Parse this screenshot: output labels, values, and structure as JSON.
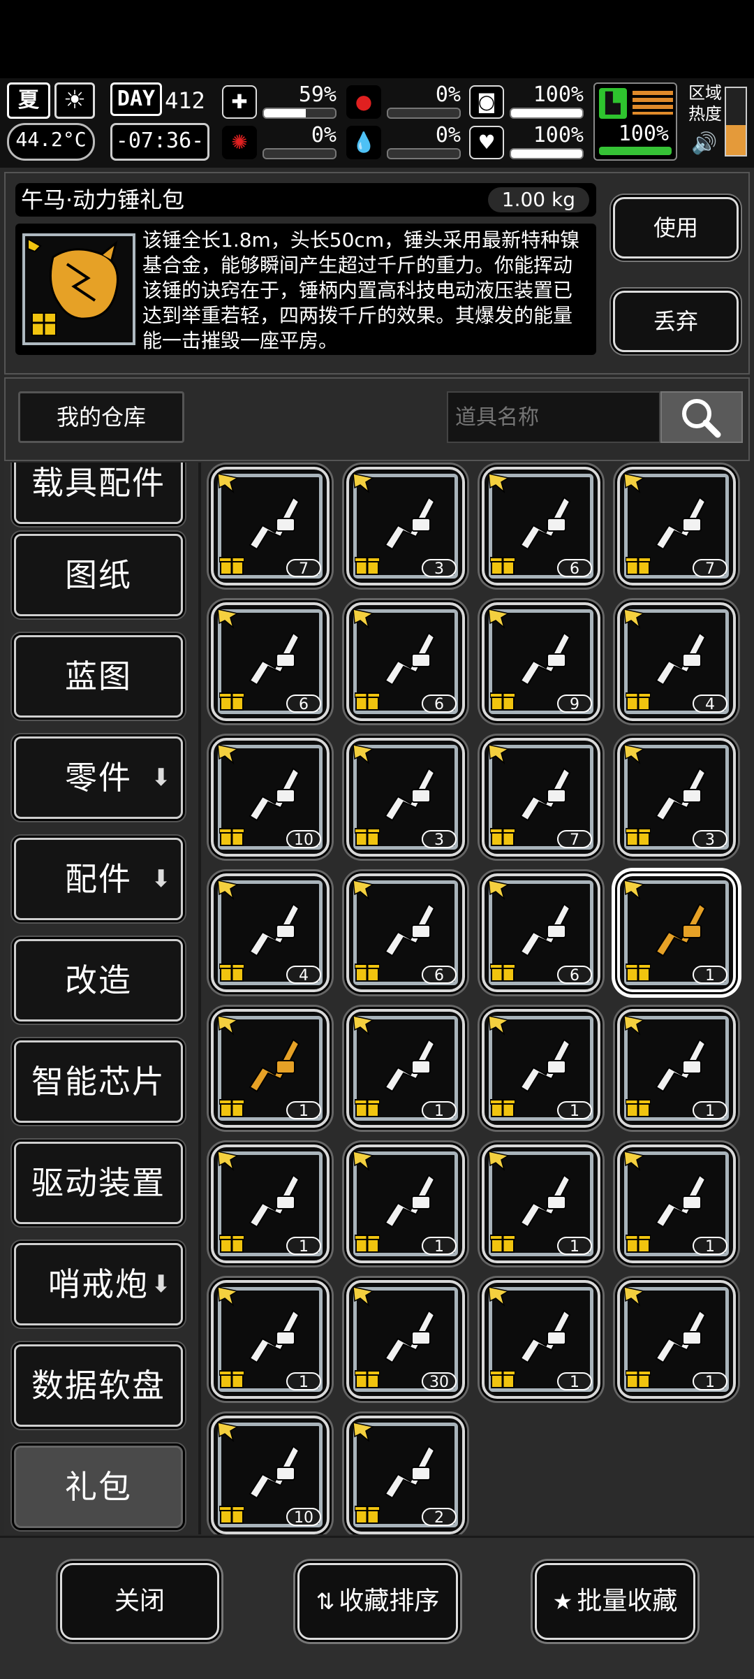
{
  "hud": {
    "season": "夏",
    "weather_icon": "sun-icon",
    "temperature": "44.2°C",
    "day_label": "DAY",
    "day_number": "412",
    "clock": "-07:36-",
    "stats": [
      {
        "name": "health",
        "icon": "medkit-icon",
        "value": "59%",
        "fill": 0.59
      },
      {
        "name": "hunger",
        "icon": "stomach-icon",
        "value": "0%",
        "fill": 0
      },
      {
        "name": "armor",
        "icon": "shield-icon",
        "value": "100%",
        "fill": 1.0
      },
      {
        "name": "sanity",
        "icon": "brain-icon",
        "value": "0%",
        "fill": 0
      },
      {
        "name": "thirst",
        "icon": "blood-drop-icon",
        "value": "0%",
        "fill": 0
      },
      {
        "name": "mood",
        "icon": "heart-icon",
        "value": "100%",
        "fill": 1.0
      }
    ],
    "stamina": "100%",
    "zone_heat_label": "区域热度"
  },
  "detail": {
    "item_name": "午马·动力锤礼包",
    "weight": "1.00 kg",
    "description": "该锤全长1.8m，头长50cm，锤头采用最新特种镍基合金，能够瞬间产生超过千斤的重力。你能挥动该锤的诀窍在于，锤柄内置高科技电动液压装置已达到举重若轻，四两拨千斤的效果。其爆发的能量能一击摧毁一座平房。",
    "use_label": "使用",
    "discard_label": "丢弃"
  },
  "storage": {
    "title": "我的仓库",
    "search_placeholder": "道具名称"
  },
  "categories": [
    {
      "label": "载具配件",
      "arrow": false
    },
    {
      "label": "图纸",
      "arrow": false
    },
    {
      "label": "蓝图",
      "arrow": false
    },
    {
      "label": "零件",
      "arrow": true
    },
    {
      "label": "配件",
      "arrow": true
    },
    {
      "label": "改造",
      "arrow": false
    },
    {
      "label": "智能芯片",
      "arrow": false
    },
    {
      "label": "驱动装置",
      "arrow": false
    },
    {
      "label": "哨戒炮",
      "arrow": true
    },
    {
      "label": "数据软盘",
      "arrow": false
    },
    {
      "label": "礼包",
      "arrow": false,
      "selected": true
    }
  ],
  "items": [
    {
      "icon": "ammo-case-icon",
      "count": "7"
    },
    {
      "icon": "grenades-icon",
      "count": "3"
    },
    {
      "icon": "riot-shield-icon",
      "count": "6"
    },
    {
      "icon": "minigun-icon",
      "count": "7"
    },
    {
      "icon": "tactical-vest-icon",
      "count": "6"
    },
    {
      "icon": "gas-mask-icon",
      "count": "6"
    },
    {
      "icon": "assault-rifle-icon",
      "count": "9"
    },
    {
      "icon": "body-armor-icon",
      "count": "4"
    },
    {
      "icon": "sniper-rifle-icon",
      "count": "10"
    },
    {
      "icon": "combat-helmet-icon",
      "count": "3"
    },
    {
      "icon": "compound-bow-icon",
      "count": "7"
    },
    {
      "icon": "knee-pads-icon",
      "count": "3"
    },
    {
      "icon": "heavy-armor-icon",
      "count": "4"
    },
    {
      "icon": "shotgun-icon",
      "count": "6"
    },
    {
      "icon": "chainsaw-icon",
      "count": "6"
    },
    {
      "icon": "golden-horse-hammer-icon",
      "count": "1",
      "selected": true,
      "gold": true
    },
    {
      "icon": "golden-dragon-blade-icon",
      "count": "1",
      "gold": true
    },
    {
      "icon": "crossbow-icon",
      "count": "1"
    },
    {
      "icon": "katana-icon",
      "count": "1"
    },
    {
      "icon": "scorpion-whip-icon",
      "count": "1"
    },
    {
      "icon": "ornate-spear-icon",
      "count": "1"
    },
    {
      "icon": "heavy-machine-gun-icon",
      "count": "1"
    },
    {
      "icon": "dragon-chainsaw-icon",
      "count": "1"
    },
    {
      "icon": "gatling-gauntlet-icon",
      "count": "1"
    },
    {
      "icon": "chain-bow-icon",
      "count": "1"
    },
    {
      "icon": "dragon-cannon-icon",
      "count": "30"
    },
    {
      "icon": "turret-gun-icon",
      "count": "1"
    },
    {
      "icon": "serrated-sword-icon",
      "count": "1"
    },
    {
      "icon": "bricks-icon",
      "count": "10"
    },
    {
      "icon": "exoskeleton-icon",
      "count": "2"
    }
  ],
  "bottom": {
    "close_label": "关闭",
    "sort_label": "收藏排序",
    "batch_label": "批量收藏"
  }
}
